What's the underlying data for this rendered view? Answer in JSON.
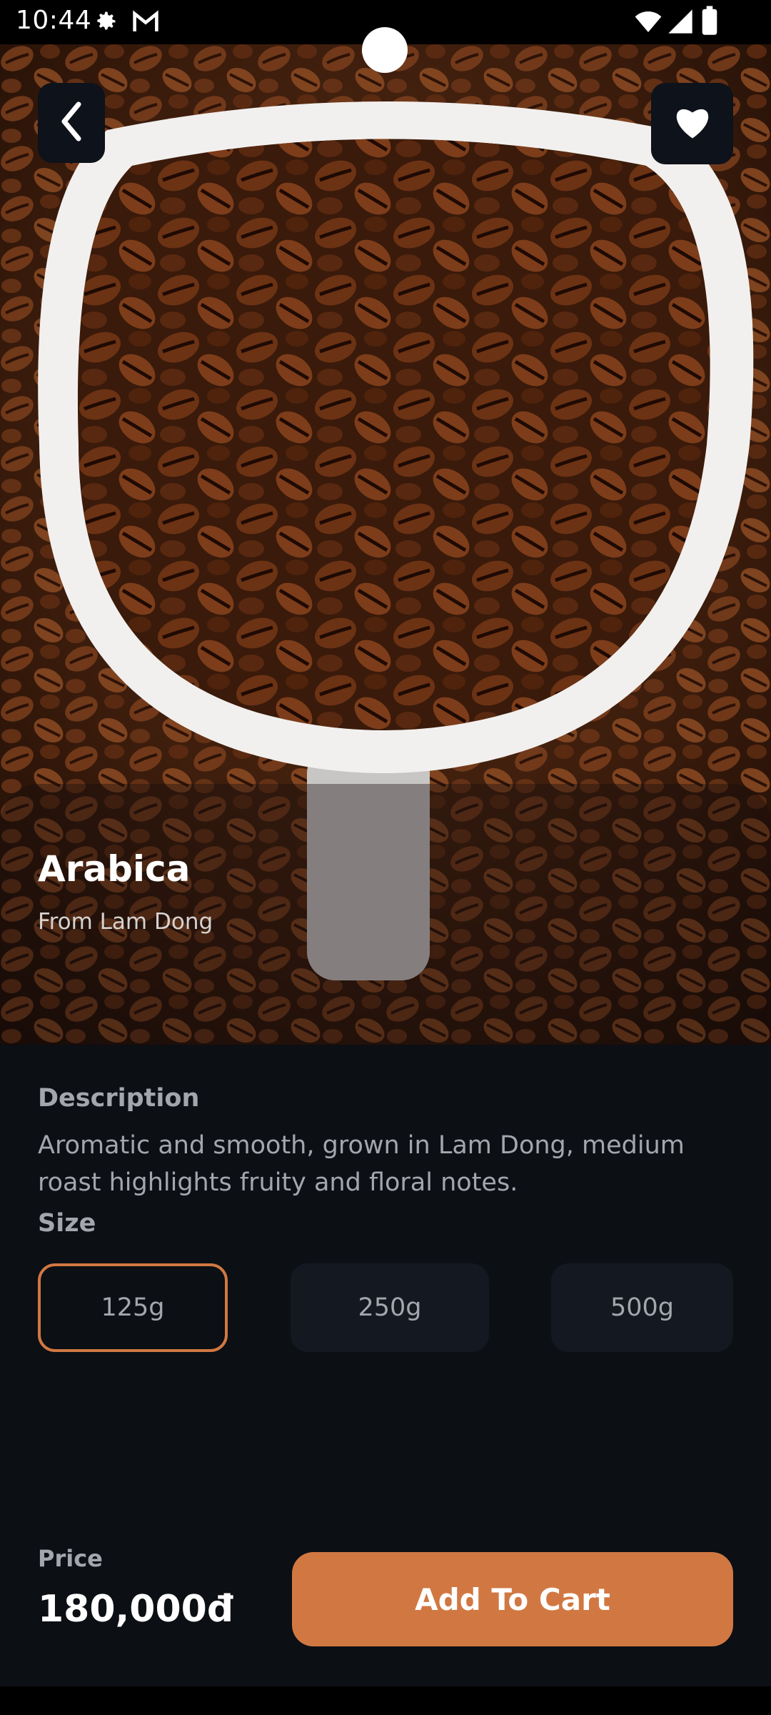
{
  "status_bar": {
    "time": "10:44",
    "left_icons": [
      "gear-icon",
      "gmail-icon"
    ],
    "right_icons": [
      "wifi-icon",
      "signal-icon",
      "battery-icon"
    ]
  },
  "header": {
    "back_icon": "chevron-left-icon",
    "favorite_icon": "heart-icon"
  },
  "product": {
    "name": "Arabica",
    "origin": "From Lam Dong",
    "image": "coffee-beans-in-white-scoop"
  },
  "description": {
    "label": "Description",
    "text": "Aromatic and smooth, grown in Lam Dong, medium roast highlights fruity and floral notes."
  },
  "size": {
    "label": "Size",
    "options": [
      "125g",
      "250g",
      "500g"
    ],
    "selected": "125g"
  },
  "price": {
    "label": "Price",
    "value": "180,000đ"
  },
  "cart": {
    "label": "Add To Cart"
  },
  "colors": {
    "accent": "#D17842",
    "background": "#0C0F14",
    "surface": "#141821",
    "muted_text": "#A4A6AD"
  }
}
